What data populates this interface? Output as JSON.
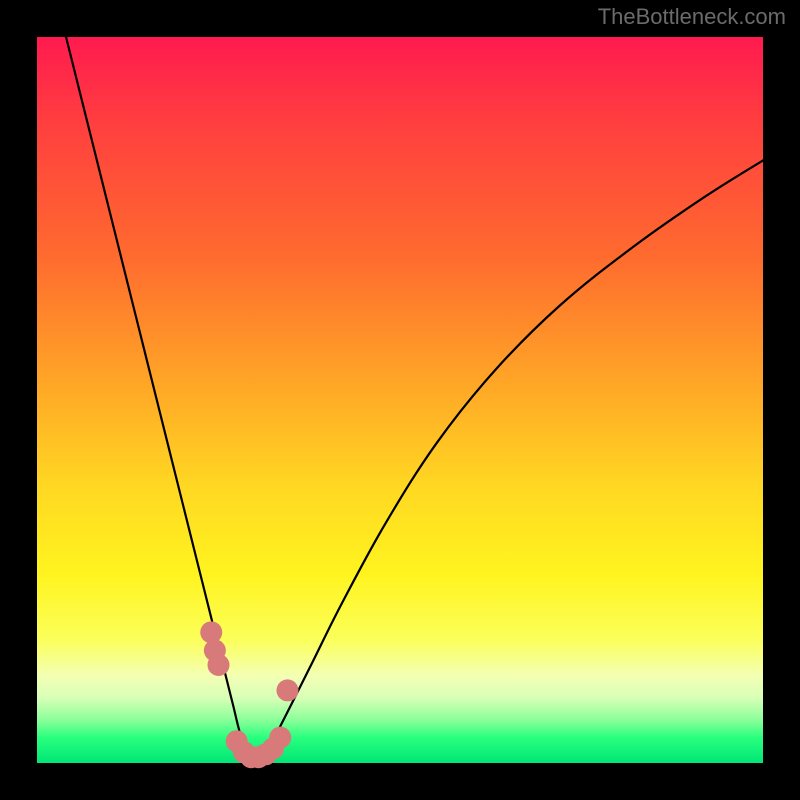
{
  "watermark": "TheBottleneck.com",
  "chart_data": {
    "type": "line",
    "title": "",
    "xlabel": "",
    "ylabel": "",
    "xlim": [
      0,
      100
    ],
    "ylim": [
      0,
      100
    ],
    "series": [
      {
        "name": "bottleneck-curve",
        "x": [
          4,
          6,
          8,
          10,
          12,
          14,
          16,
          18,
          20,
          22,
          24,
          26,
          27,
          28,
          29,
          30,
          31,
          32,
          33,
          35,
          38,
          42,
          48,
          55,
          63,
          72,
          82,
          92,
          100
        ],
        "values": [
          100,
          92,
          84,
          76,
          68,
          60,
          52,
          44,
          36,
          28,
          20,
          12,
          8,
          4,
          1.5,
          0.5,
          0.5,
          1.5,
          4,
          8,
          14,
          22,
          33,
          44,
          54,
          63,
          71,
          78,
          83
        ]
      }
    ],
    "markers": {
      "name": "highlight-points",
      "color": "#d97a7a",
      "x": [
        24.0,
        24.5,
        25.0,
        27.5,
        28.5,
        29.5,
        30.5,
        31.5,
        32.5,
        33.5,
        34.5
      ],
      "values": [
        18.0,
        15.5,
        13.5,
        3.0,
        1.5,
        0.8,
        0.8,
        1.2,
        2.0,
        3.5,
        10.0
      ]
    }
  }
}
